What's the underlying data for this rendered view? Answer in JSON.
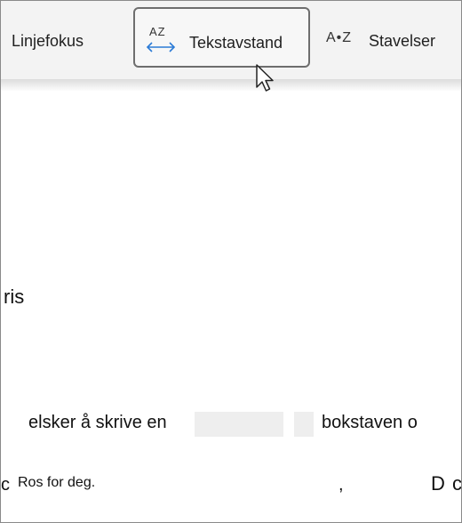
{
  "toolbar": {
    "line_focus_label": "Linjefokus",
    "text_spacing_label": "Tekstavstand",
    "text_spacing_icon": "text-spacing-icon",
    "text_spacing_icon_text": "AZ",
    "syllables_label": "Stavelser",
    "syllables_icon": "syllables-icon",
    "syllables_icon_text": "A•Z"
  },
  "document": {
    "fragment_ris": "ris",
    "fragment_elsker": "elsker å skrive en",
    "fragment_bokstaven": "bokstaven o",
    "fragment_c": "c",
    "fragment_ros": "Ros for deg.",
    "fragment_comma": ",",
    "fragment_d": "D",
    "fragment_c2": "c"
  },
  "colors": {
    "accent_blue": "#2b7bd6",
    "toolbar_bg": "#f3f3f3",
    "selected_border": "#6e6e6e"
  }
}
